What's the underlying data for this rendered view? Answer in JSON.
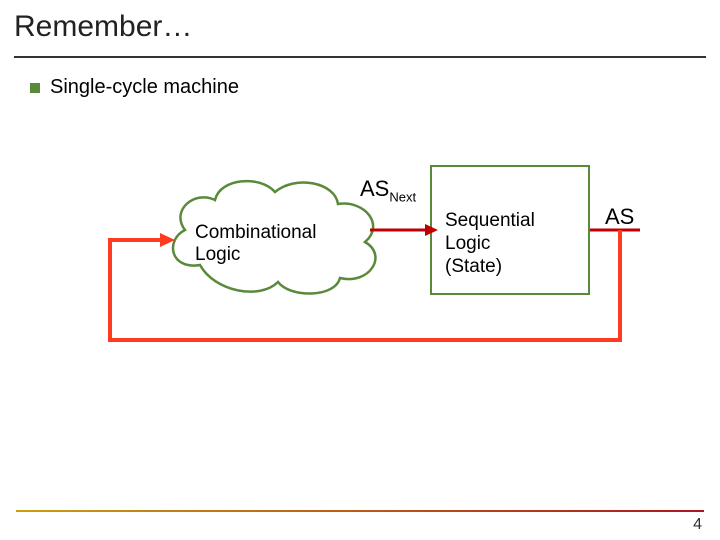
{
  "title": "Remember…",
  "bullet": "Single-cycle machine",
  "cloud_label_line1": "Combinational",
  "cloud_label_line2": "Logic",
  "rect_label_line1": "Sequential",
  "rect_label_line2": "Logic",
  "rect_label_line3": "(State)",
  "signal_next_base": "AS",
  "signal_next_sub": "Next",
  "signal_out": "AS",
  "page_number": "4"
}
